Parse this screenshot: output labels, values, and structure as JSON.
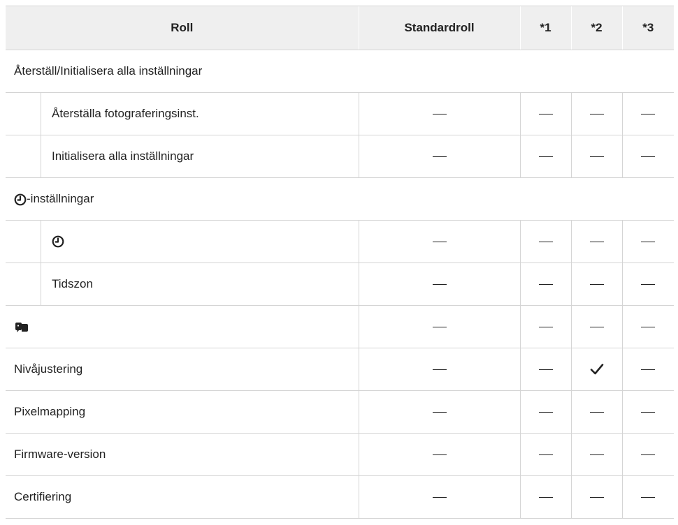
{
  "header": {
    "role": "Roll",
    "default_role": "Standardroll",
    "col1": "*1",
    "col2": "*2",
    "col3": "*3"
  },
  "rows": [
    {
      "label": "Återställ/Initialisera alla inställningar",
      "type": "group"
    },
    {
      "label": "Återställa fotograferingsinst.",
      "type": "sub",
      "values": [
        "—",
        "—",
        "—",
        "—"
      ]
    },
    {
      "label": "Initialisera alla inställningar",
      "type": "sub",
      "values": [
        "—",
        "—",
        "—",
        "—"
      ]
    },
    {
      "label": "-inställningar",
      "icon": "clock-icon",
      "type": "group"
    },
    {
      "label": "",
      "icon": "clock-icon",
      "type": "sub",
      "values": [
        "—",
        "—",
        "—",
        "—"
      ]
    },
    {
      "label": "Tidszon",
      "type": "sub",
      "values": [
        "—",
        "—",
        "—",
        "—"
      ]
    },
    {
      "label": "",
      "icon": "language-icon",
      "type": "row",
      "values": [
        "—",
        "—",
        "—",
        "—"
      ]
    },
    {
      "label": "Nivåjustering",
      "type": "row",
      "values": [
        "—",
        "—",
        "check",
        "—"
      ]
    },
    {
      "label": "Pixelmapping",
      "type": "row",
      "values": [
        "—",
        "—",
        "—",
        "—"
      ]
    },
    {
      "label": "Firmware-version",
      "type": "row",
      "values": [
        "—",
        "—",
        "—",
        "—"
      ]
    },
    {
      "label": "Certifiering",
      "type": "row",
      "values": [
        "—",
        "—",
        "—",
        "—"
      ]
    }
  ]
}
